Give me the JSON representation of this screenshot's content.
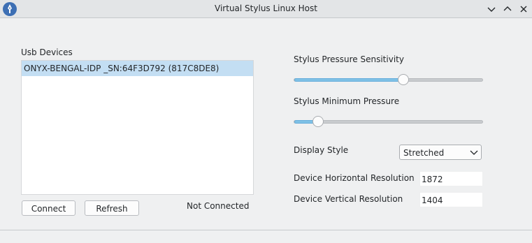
{
  "window": {
    "title": "Virtual Stylus Linux Host"
  },
  "usb": {
    "label": "Usb Devices",
    "devices": [
      {
        "name": "ONYX-BENGAL-IDP _SN:64F3D792 (817C8DE8)"
      }
    ],
    "connect_label": "Connect",
    "refresh_label": "Refresh",
    "status": "Not Connected"
  },
  "pressure": {
    "label": "Stylus Pressure Sensitivity",
    "value_fraction": 0.58
  },
  "min_pressure": {
    "label": "Stylus Minimum Pressure",
    "value_fraction": 0.13
  },
  "display": {
    "label": "Display Style",
    "value": "Stretched"
  },
  "resolution": {
    "horizontal_label": "Device Horizontal Resolution",
    "horizontal_value": "1872",
    "vertical_label": "Device Vertical Resolution",
    "vertical_value": "1404"
  },
  "colors": {
    "accent": "#7fc1e6",
    "selection": "#c3def3"
  }
}
